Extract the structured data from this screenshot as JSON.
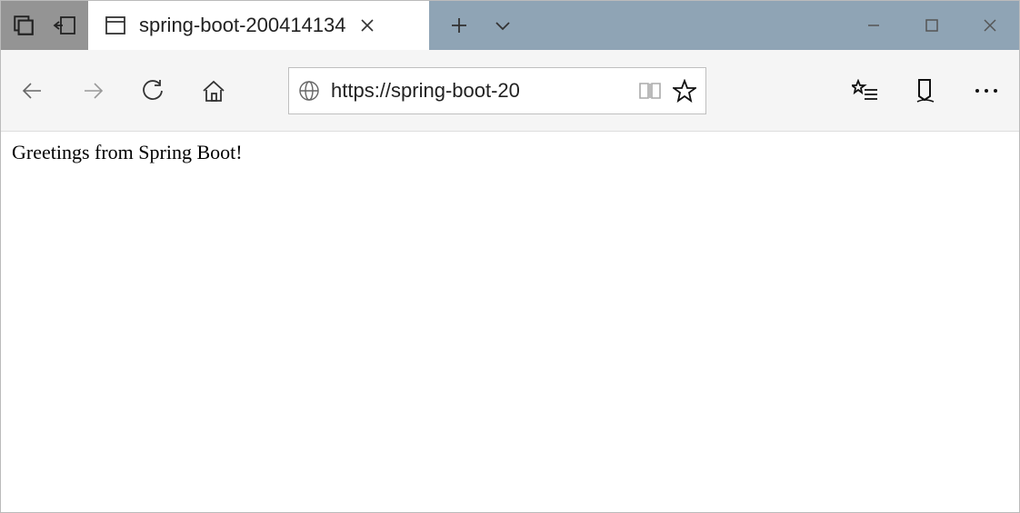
{
  "titlebar": {
    "tab_title": "spring-boot-200414134",
    "icons": {
      "tab_actions": "tab-actions-icon",
      "set_aside": "set-aside-icon",
      "page": "page-icon",
      "close": "close-icon",
      "new_tab": "plus-icon",
      "chevron": "chevron-down-icon"
    },
    "window": {
      "min": "minimize",
      "max": "maximize",
      "close": "close"
    }
  },
  "toolbar": {
    "back": "Back",
    "forward": "Forward",
    "refresh": "Refresh",
    "home": "Home",
    "globe": "globe",
    "url": "https://spring-boot-20",
    "reading": "reading-view",
    "fav": "favorite",
    "favlist": "favorites-list",
    "notes": "web-notes",
    "more": "more"
  },
  "page": {
    "greeting": "Greetings from Spring Boot!"
  }
}
